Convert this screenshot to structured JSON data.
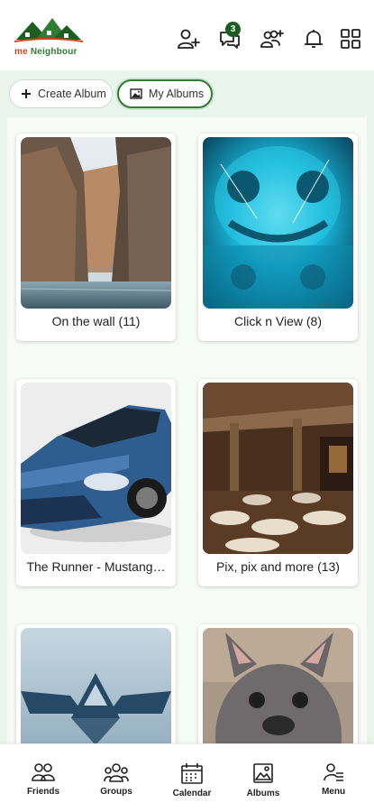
{
  "app": {
    "logo_prefix": "me",
    "logo_suffix": "Neighbour",
    "messages_badge": "3"
  },
  "header_icons": [
    "add-friend-icon",
    "messages-icon",
    "group-add-icon",
    "notification-bell-icon",
    "apps-grid-icon"
  ],
  "actions": {
    "create_album": "Create Album",
    "my_albums": "My Albums"
  },
  "albums": [
    {
      "title": "On the wall (11)",
      "image": "canyon-river"
    },
    {
      "title": "Click n View (8)",
      "image": "glowing-blue-face"
    },
    {
      "title": "The Runner - Mustang…",
      "image": "blue-sports-car"
    },
    {
      "title": "Pix, pix and more (13)",
      "image": "restaurant-interior"
    },
    {
      "title": "",
      "image": "triforce-crest"
    },
    {
      "title": "",
      "image": "french-bulldog"
    }
  ],
  "nav": {
    "friends": "Friends",
    "groups": "Groups",
    "calendar": "Calendar",
    "albums": "Albums",
    "menu": "Menu"
  },
  "colors": {
    "brand_green": "#2e7d32",
    "brand_orange": "#d84315",
    "content_bg": "#e9f5ec"
  }
}
